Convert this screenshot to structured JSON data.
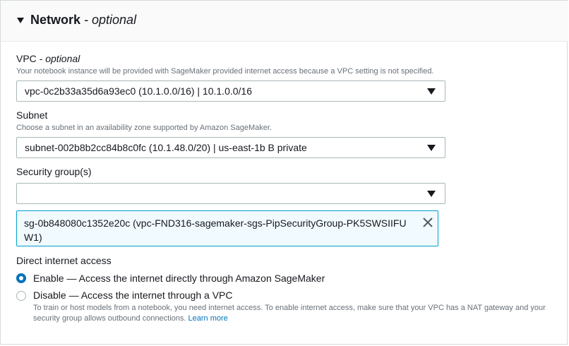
{
  "section": {
    "title": "Network",
    "title_optional": " - optional"
  },
  "vpc": {
    "label": "VPC",
    "label_optional": " - optional",
    "description": "Your notebook instance will be provided with SageMaker provided internet access because a VPC setting is not specified.",
    "selected": "vpc-0c2b33a35d6a93ec0 (10.1.0.0/16) | 10.1.0.0/16"
  },
  "subnet": {
    "label": "Subnet",
    "description": "Choose a subnet in an availability zone supported by Amazon SageMaker.",
    "selected": "subnet-002b8b2cc84b8c0fc (10.1.48.0/20) | us-east-1b B private"
  },
  "security_groups": {
    "label": "Security group(s)",
    "selected": "",
    "token": "sg-0b848080c1352e20c (vpc-FND316-sagemaker-sgs-PipSecurityGroup-PK5SWSIIFUW1)"
  },
  "internet_access": {
    "label": "Direct internet access",
    "options": [
      {
        "label": "Enable — Access the internet directly through Amazon SageMaker",
        "selected": true
      },
      {
        "label": "Disable — Access the internet through a VPC",
        "selected": false,
        "description": "To train or host models from a notebook, you need internet access. To enable internet access, make sure that your VPC has a NAT gateway and your security group allows outbound connections.",
        "link": "Learn more"
      }
    ]
  },
  "colors": {
    "accent": "#0073bb",
    "token_border": "#00a1c9",
    "token_bg": "#f1faff",
    "muted_text": "#687078"
  }
}
